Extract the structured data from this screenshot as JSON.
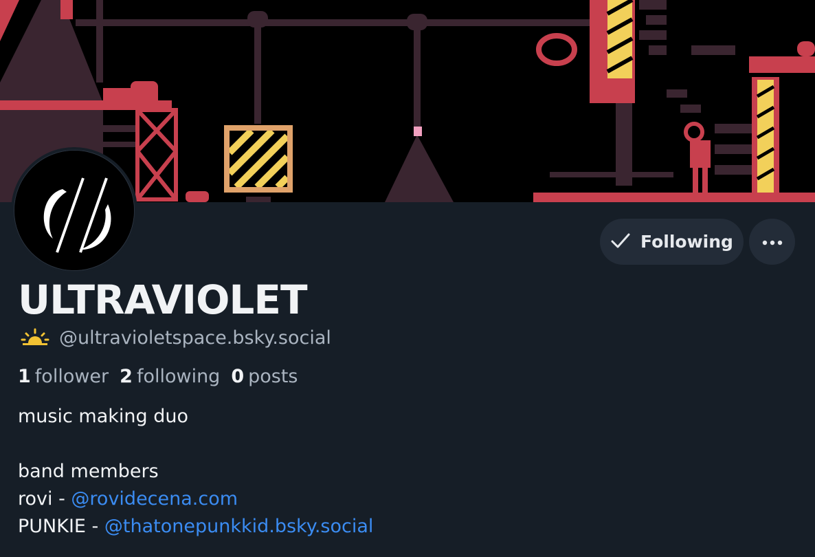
{
  "profile": {
    "display_name": "ULTRAVIOLET",
    "handle": "@ultravioletspace.bsky.social",
    "handle_icon": "sun-rise-icon",
    "stats": {
      "followers_count": "1",
      "followers_label": "follower",
      "following_count": "2",
      "following_label": "following",
      "posts_count": "0",
      "posts_label": "posts"
    },
    "bio": {
      "line1": "music making duo",
      "line2": "band members",
      "member1_prefix": "rovi - ",
      "member1_link": "@rovidecena.com",
      "member2_prefix": "PUNKIE - ",
      "member2_link": "@thatonepunkkid.bsky.social"
    }
  },
  "actions": {
    "following_label": "Following",
    "more_icon": "ellipsis-icon"
  },
  "colors": {
    "background": "#161e27",
    "button_bg": "#232c38",
    "link": "#3b8cf2",
    "muted_text": "#aab4c0",
    "banner_red": "#c8404e",
    "banner_yellow": "#f2d05a",
    "banner_dark": "#3a2530"
  }
}
